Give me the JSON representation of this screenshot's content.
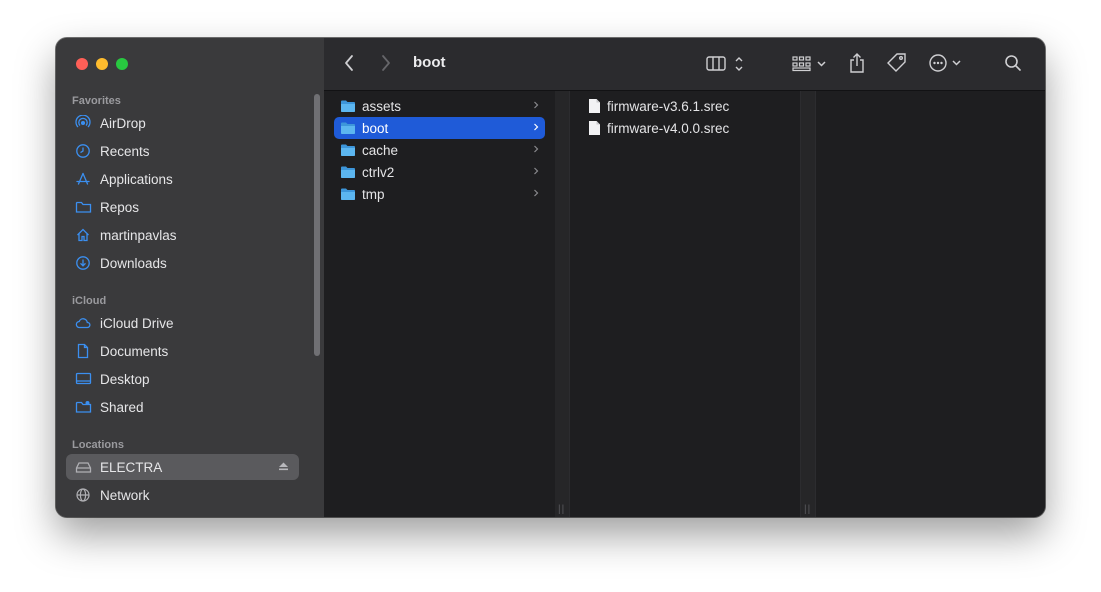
{
  "window": {
    "title": "boot"
  },
  "sidebar": {
    "sections": [
      {
        "label": "Favorites",
        "items": [
          {
            "label": "AirDrop",
            "icon": "airdrop-icon"
          },
          {
            "label": "Recents",
            "icon": "clock-icon"
          },
          {
            "label": "Applications",
            "icon": "applications-icon"
          },
          {
            "label": "Repos",
            "icon": "folder-icon"
          },
          {
            "label": "martinpavlas",
            "icon": "home-icon"
          },
          {
            "label": "Downloads",
            "icon": "download-icon"
          }
        ]
      },
      {
        "label": "iCloud",
        "items": [
          {
            "label": "iCloud Drive",
            "icon": "cloud-icon"
          },
          {
            "label": "Documents",
            "icon": "document-icon"
          },
          {
            "label": "Desktop",
            "icon": "desktop-icon"
          },
          {
            "label": "Shared",
            "icon": "shared-folder-icon"
          }
        ]
      },
      {
        "label": "Locations",
        "items": [
          {
            "label": "ELECTRA",
            "icon": "drive-icon",
            "selected": true,
            "eject": "eject-icon"
          },
          {
            "label": "Network",
            "icon": "network-icon"
          }
        ]
      }
    ]
  },
  "columns": [
    {
      "items": [
        {
          "label": "assets",
          "type": "folder"
        },
        {
          "label": "boot",
          "type": "folder",
          "selected": true
        },
        {
          "label": "cache",
          "type": "folder"
        },
        {
          "label": "ctrlv2",
          "type": "folder"
        },
        {
          "label": "tmp",
          "type": "folder"
        }
      ]
    },
    {
      "items": [
        {
          "label": "firmware-v3.6.1.srec",
          "type": "file"
        },
        {
          "label": "firmware-v4.0.0.srec",
          "type": "file"
        }
      ]
    }
  ],
  "colors": {
    "accent": "#1f5bd8",
    "folder": "#4aa8e8",
    "sidebar_icon": "#3b8ff0"
  }
}
